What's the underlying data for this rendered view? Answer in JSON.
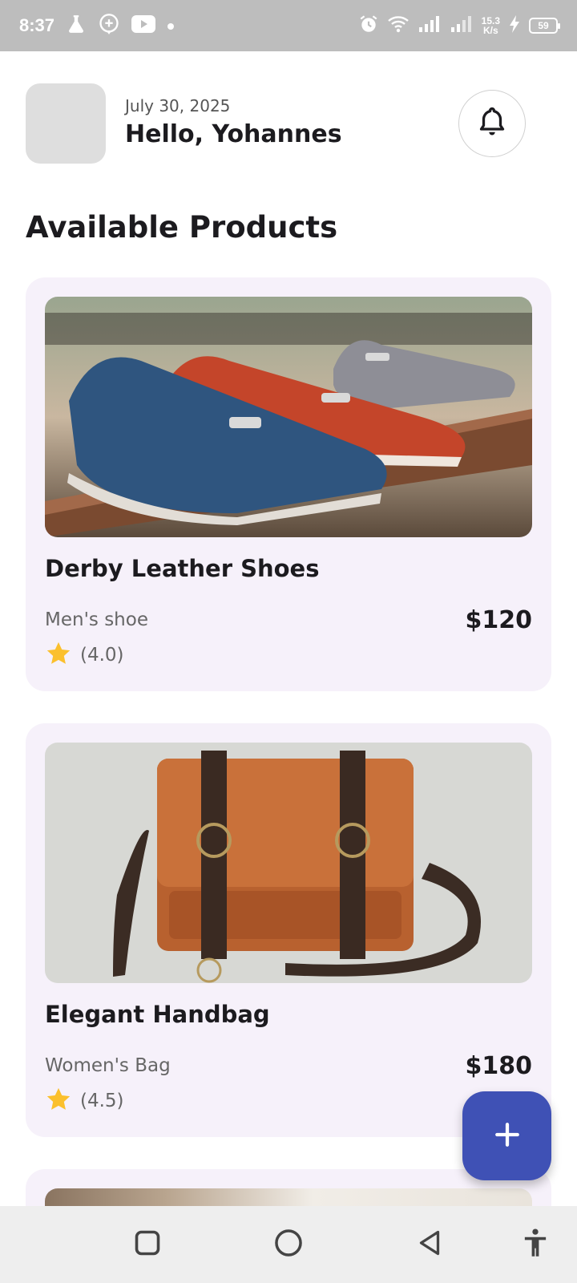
{
  "status_bar": {
    "time": "8:37",
    "speed_value": "15.3",
    "speed_unit": "K/s",
    "battery": "59"
  },
  "header": {
    "date": "July 30, 2025",
    "greeting": "Hello, Yohannes"
  },
  "section_title": "Available Products",
  "products": [
    {
      "name": "Derby Leather Shoes",
      "category": "Men's shoe",
      "price": "$120",
      "rating": "(4.0)"
    },
    {
      "name": "Elegant Handbag",
      "category": "Women's Bag",
      "price": "$180",
      "rating": "(4.5)"
    }
  ],
  "icons": {
    "status": [
      "flask-icon",
      "add-circle-icon",
      "youtube-icon",
      "alarm-icon",
      "wifi-icon",
      "signal-icon",
      "charging-icon"
    ],
    "header": "bell-icon",
    "fab": "plus-icon",
    "nav": [
      "square-recents-icon",
      "circle-home-icon",
      "triangle-back-icon",
      "accessibility-icon"
    ]
  },
  "colors": {
    "card_bg": "#f6f1fa",
    "fab_bg": "#3f51b5",
    "star": "#fbc02d",
    "status_bar_bg": "#bdbdbd",
    "nav_bar_bg": "#eeeeee"
  }
}
